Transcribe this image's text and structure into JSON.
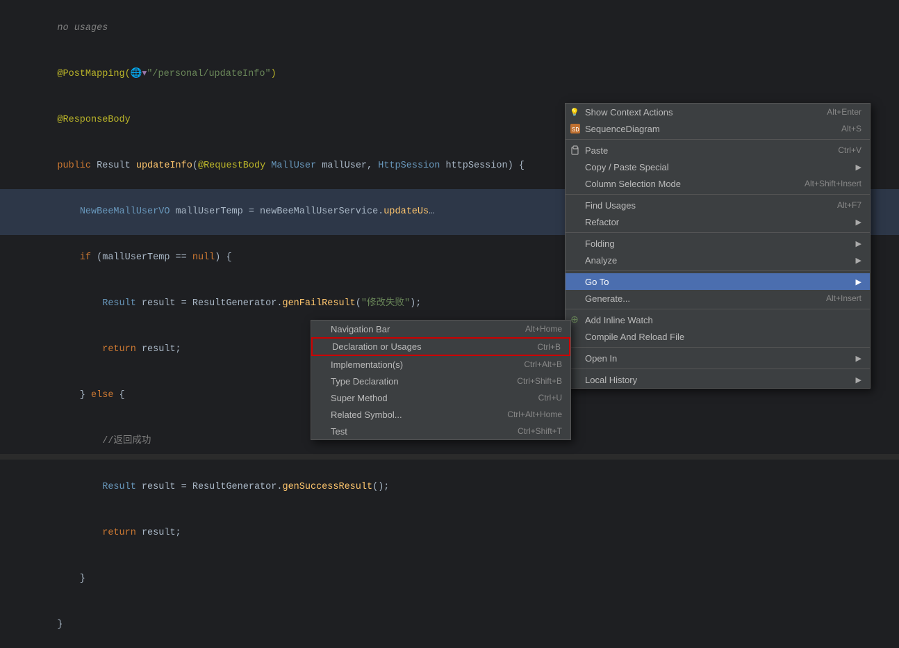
{
  "editor": {
    "lines": [
      {
        "text": "no usages",
        "class": "no-usages"
      },
      {
        "text": "@PostMapping( \"/personal/updateInfo\")",
        "class": "annotation-line"
      },
      {
        "text": "@ResponseBody",
        "class": "annotation"
      },
      {
        "text": "public Result updateInfo(@RequestBody MallUser mallUser, HttpSession httpSession) {",
        "class": "code"
      },
      {
        "text": "    NewBeeMallUserVO mallUserTemp = newBeeMallUserService.updateUs……",
        "class": "code highlight-bg"
      },
      {
        "text": "    if (mallUserTemp == null) {",
        "class": "code"
      },
      {
        "text": "        Result result = ResultGenerator.genFailResult(\"修改失败\");",
        "class": "code"
      },
      {
        "text": "        return result;",
        "class": "code"
      },
      {
        "text": "    } else {",
        "class": "code"
      },
      {
        "text": "        //返回成功",
        "class": "comment"
      },
      {
        "text": "        Result result = ResultGenerator.genSuccessResult();",
        "class": "code"
      },
      {
        "text": "        return result;",
        "class": "code"
      },
      {
        "text": "    }",
        "class": "code"
      },
      {
        "text": "}",
        "class": "code"
      }
    ]
  },
  "main_menu": {
    "items": [
      {
        "id": "show-context-actions",
        "icon": "bulb",
        "label": "Show Context Actions",
        "shortcut": "Alt+Enter",
        "arrow": false,
        "separator_after": false
      },
      {
        "id": "sequence-diagram",
        "icon": "seq",
        "label": "SequenceDiagram",
        "shortcut": "Alt+S",
        "arrow": false,
        "separator_after": true
      },
      {
        "id": "paste",
        "icon": "paste",
        "label": "Paste",
        "shortcut": "Ctrl+V",
        "arrow": false,
        "separator_after": false
      },
      {
        "id": "copy-paste-special",
        "icon": "",
        "label": "Copy / Paste Special",
        "shortcut": "",
        "arrow": true,
        "separator_after": false
      },
      {
        "id": "column-selection",
        "icon": "",
        "label": "Column Selection Mode",
        "shortcut": "Alt+Shift+Insert",
        "arrow": false,
        "separator_after": true
      },
      {
        "id": "find-usages",
        "icon": "",
        "label": "Find Usages",
        "shortcut": "Alt+F7",
        "arrow": false,
        "separator_after": false
      },
      {
        "id": "refactor",
        "icon": "",
        "label": "Refactor",
        "shortcut": "",
        "arrow": true,
        "separator_after": true
      },
      {
        "id": "folding",
        "icon": "",
        "label": "Folding",
        "shortcut": "",
        "arrow": true,
        "separator_after": false
      },
      {
        "id": "analyze",
        "icon": "",
        "label": "Analyze",
        "shortcut": "",
        "arrow": true,
        "separator_after": true
      },
      {
        "id": "goto",
        "icon": "",
        "label": "Go To",
        "shortcut": "",
        "arrow": true,
        "separator_after": false,
        "highlighted": true
      },
      {
        "id": "generate",
        "icon": "",
        "label": "Generate...",
        "shortcut": "Alt+Insert",
        "arrow": false,
        "separator_after": true
      },
      {
        "id": "add-inline-watch",
        "icon": "watch",
        "label": "Add Inline Watch",
        "shortcut": "",
        "arrow": false,
        "separator_after": false
      },
      {
        "id": "compile-reload",
        "icon": "",
        "label": "Compile And Reload File",
        "shortcut": "",
        "arrow": false,
        "separator_after": true
      },
      {
        "id": "open-in",
        "icon": "",
        "label": "Open In",
        "shortcut": "",
        "arrow": true,
        "separator_after": true
      },
      {
        "id": "local-history",
        "icon": "",
        "label": "Local History",
        "shortcut": "",
        "arrow": true,
        "separator_after": false
      }
    ]
  },
  "sub_menu": {
    "items": [
      {
        "id": "navigation-bar",
        "label": "Navigation Bar",
        "shortcut": "Alt+Home",
        "bordered": false
      },
      {
        "id": "declaration-or-usages",
        "label": "Declaration or Usages",
        "shortcut": "Ctrl+B",
        "bordered": true
      },
      {
        "id": "implementations",
        "label": "Implementation(s)",
        "shortcut": "Ctrl+Alt+B",
        "bordered": false
      },
      {
        "id": "type-declaration",
        "label": "Type Declaration",
        "shortcut": "Ctrl+Shift+B",
        "bordered": false
      },
      {
        "id": "super-method",
        "label": "Super Method",
        "shortcut": "Ctrl+U",
        "bordered": false
      },
      {
        "id": "related-symbol",
        "label": "Related Symbol...",
        "shortcut": "Ctrl+Alt+Home",
        "bordered": false
      },
      {
        "id": "test",
        "label": "Test",
        "shortcut": "Ctrl+Shift+T",
        "bordered": false
      }
    ]
  }
}
